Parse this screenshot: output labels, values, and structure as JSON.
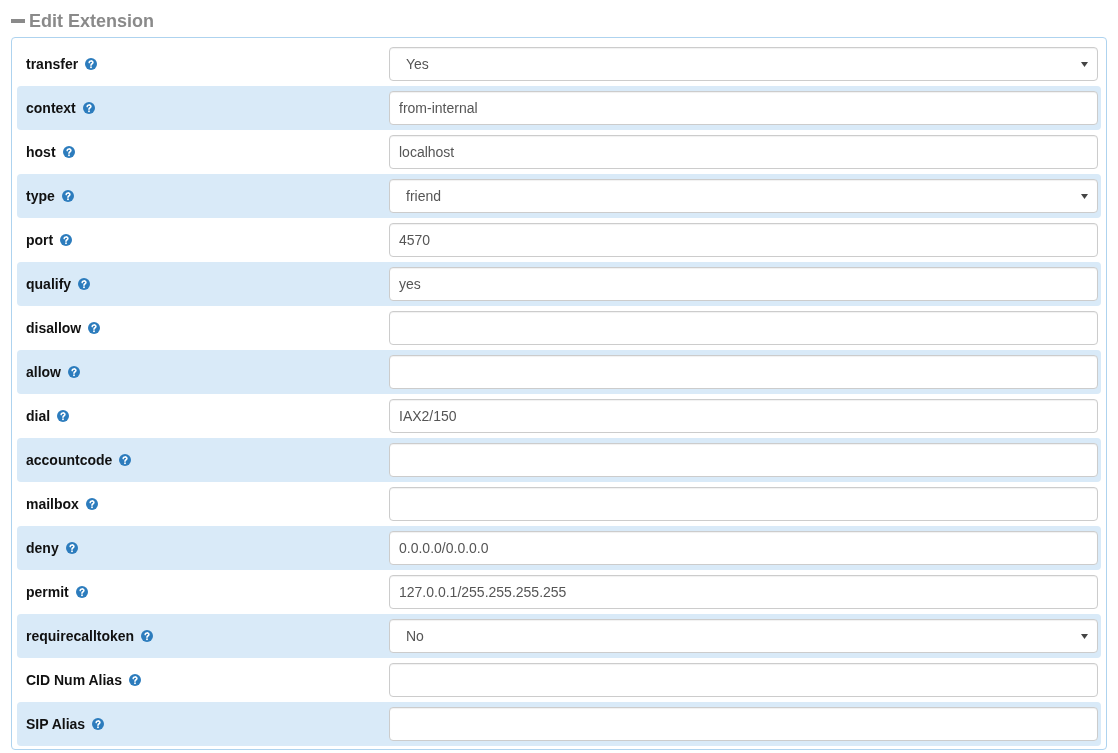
{
  "section": {
    "title": "Edit Extension",
    "expanded": true
  },
  "fields": [
    {
      "label": "transfer",
      "kind": "select",
      "value": "Yes"
    },
    {
      "label": "context",
      "kind": "text",
      "value": "from-internal"
    },
    {
      "label": "host",
      "kind": "text",
      "value": "localhost"
    },
    {
      "label": "type",
      "kind": "select",
      "value": "friend"
    },
    {
      "label": "port",
      "kind": "text",
      "value": "4570"
    },
    {
      "label": "qualify",
      "kind": "text",
      "value": "yes"
    },
    {
      "label": "disallow",
      "kind": "text"
    },
    {
      "label": "allow",
      "kind": "text"
    },
    {
      "label": "dial",
      "kind": "text",
      "value": "IAX2/150"
    },
    {
      "label": "accountcode",
      "kind": "text"
    },
    {
      "label": "mailbox",
      "kind": "text"
    },
    {
      "label": "deny",
      "kind": "text",
      "value": "0.0.0.0/0.0.0.0"
    },
    {
      "label": "permit",
      "kind": "text",
      "value": "127.0.0.1/255.255.255.255"
    },
    {
      "label": "requirecalltoken",
      "kind": "select",
      "value": "No"
    },
    {
      "label": "CID Num Alias",
      "kind": "text"
    },
    {
      "label": "SIP Alias",
      "kind": "text"
    }
  ]
}
